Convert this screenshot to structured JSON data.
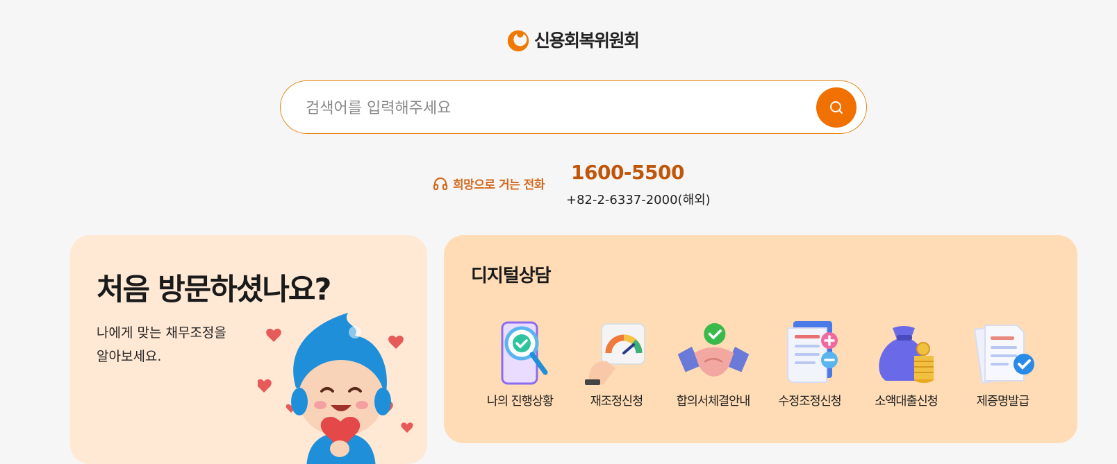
{
  "logo": {
    "text": "신용회복위원회"
  },
  "search": {
    "placeholder": "검색어를 입력해주세요",
    "value": ""
  },
  "hotline": {
    "label": "희망으로 거는 전화",
    "number": "1600-5500",
    "overseas": "+82-2-6337-2000(해외)"
  },
  "intro_card": {
    "title": "처음 방문하셨나요?",
    "line1": "나에게 맞는 채무조정을",
    "line2": "알아보세요."
  },
  "digital": {
    "title": "디지털상담",
    "items": [
      {
        "label": "나의 진행상황",
        "icon": "magnifier-check-icon"
      },
      {
        "label": "재조정신청",
        "icon": "gauge-puzzle-icon"
      },
      {
        "label": "합의서체결안내",
        "icon": "handshake-icon"
      },
      {
        "label": "수정조정신청",
        "icon": "document-plus-minus-icon"
      },
      {
        "label": "소액대출신청",
        "icon": "money-bag-coins-icon"
      },
      {
        "label": "제증명발급",
        "icon": "document-check-icon"
      }
    ]
  },
  "colors": {
    "accent": "#f07000",
    "hotline": "#c0560a",
    "intro_bg": "#ffe9d5",
    "digital_bg": "#ffdcb5"
  }
}
